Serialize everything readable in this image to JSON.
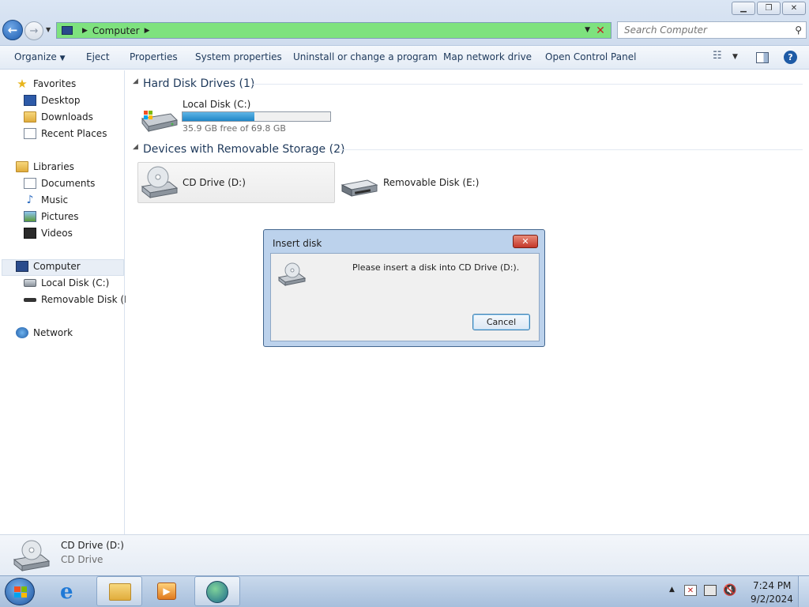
{
  "window": {
    "caption_buttons": [
      "minimize-icon",
      "restore-icon",
      "close-icon"
    ]
  },
  "address": {
    "location": "Computer"
  },
  "search": {
    "placeholder": "Search Computer"
  },
  "toolbar": {
    "organize": "Organize",
    "eject": "Eject",
    "properties": "Properties",
    "system_properties": "System properties",
    "uninstall": "Uninstall or change a program",
    "map_drive": "Map network drive",
    "control_panel": "Open Control Panel"
  },
  "sidebar": {
    "favorites": "Favorites",
    "desktop": "Desktop",
    "downloads": "Downloads",
    "recent": "Recent Places",
    "libraries": "Libraries",
    "documents": "Documents",
    "music": "Music",
    "pictures": "Pictures",
    "videos": "Videos",
    "computer": "Computer",
    "local_disk": "Local Disk (C:)",
    "removable": "Removable Disk (E:)",
    "network": "Network"
  },
  "content": {
    "hdd_group": "Hard Disk Drives (1)",
    "removable_group": "Devices with Removable Storage (2)",
    "drive_c": {
      "label": "Local Disk (C:)",
      "free": "35.9 GB free of 69.8 GB",
      "used_fraction": 0.486
    },
    "drive_d": {
      "label": "CD Drive (D:)"
    },
    "drive_e": {
      "label": "Removable Disk (E:)"
    }
  },
  "details": {
    "name": "CD Drive (D:)",
    "type": "CD Drive"
  },
  "dialog": {
    "title": "Insert disk",
    "message": "Please insert a disk into CD Drive (D:).",
    "cancel": "Cancel"
  },
  "taskbar": {
    "time": "7:24 PM",
    "date": "9/2/2024"
  }
}
